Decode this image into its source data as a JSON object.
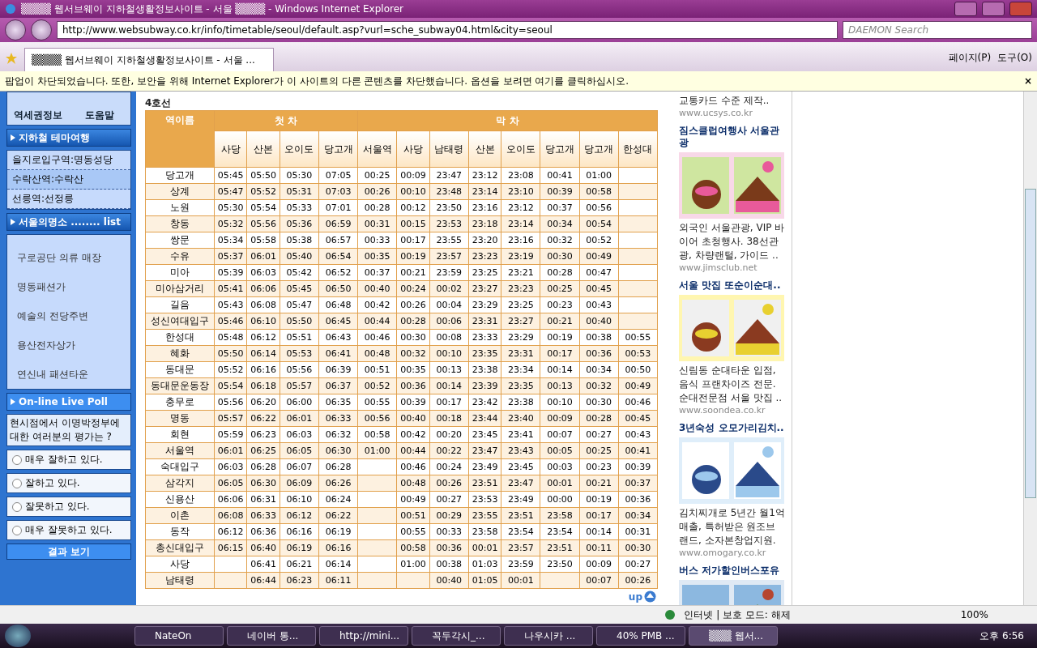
{
  "window": {
    "title": "▒▒▒▒ 웹서브웨이 지하철생활정보사이트 - 서울 ▒▒▒▒ - Windows Internet Explorer"
  },
  "address_bar": {
    "url": "http://www.websubway.co.kr/info/timetable/seoul/default.asp?vurl=sche_subway04.html&city=seoul",
    "search_placeholder": "DAEMON Search"
  },
  "tab": {
    "label": "▒▒▒▒ 웹서브웨이 지하철생활정보사이트 - 서울 ...",
    "selected": true
  },
  "toolbar": {
    "page_menu": "페이지(P)",
    "tools_menu": "도구(O)"
  },
  "info_bar": {
    "text": "팝업이 차단되었습니다. 또한, 보안을 위해 Internet Explorer가 이 사이트의 다른 콘텐츠를 차단했습니다. 옵션을 보려면 여기를 클릭하십시오.",
    "close": "×"
  },
  "sidebar": {
    "top_links": [
      "역세권정보",
      "도움말"
    ],
    "theme_travel": {
      "title": "지하철 테마여행",
      "items": [
        {
          "label": "을지로입구역:명동성당",
          "selected": false
        },
        {
          "label": "수락산역:수락산",
          "selected": true
        },
        {
          "label": "선릉역:선정릉",
          "selected": false
        }
      ]
    },
    "attractions": {
      "title": "서울의명소 ........ list",
      "items": [
        "구로공단 의류 매장",
        "명동패션가",
        "예술의 전당주변",
        "용산전자상가",
        "연신내 패션타운"
      ]
    },
    "poll": {
      "title": "On-line Live Poll",
      "question": "현시점에서 이명박정부에 대한 여러분의 평가는 ?",
      "options": [
        {
          "label": "매우 잘하고 있다.",
          "checked": false
        },
        {
          "label": "잘하고 있다.",
          "checked": false
        },
        {
          "label": "잘못하고 있다.",
          "checked": false
        },
        {
          "label": "매우 잘못하고 있다.",
          "checked": false
        }
      ],
      "button": "결과 보기"
    }
  },
  "timetable": {
    "line": "4호선",
    "station_header": "역이름",
    "groups": [
      {
        "label": "첫 차",
        "columns": [
          "사당",
          "산본",
          "오이도",
          "당고개"
        ]
      },
      {
        "label": "막 차",
        "columns": [
          "서울역",
          "사당",
          "남태령",
          "산본",
          "오이도",
          "당고개",
          "당고개",
          "한성대"
        ]
      }
    ],
    "rows": [
      {
        "station": "당고개",
        "cells": [
          "05:45",
          "05:50",
          "05:30",
          "07:05",
          "00:25",
          "00:09",
          "23:47",
          "23:12",
          "23:08",
          "00:41",
          "01:00",
          null
        ]
      },
      {
        "station": "상계",
        "cells": [
          "05:47",
          "05:52",
          "05:31",
          "07:03",
          "00:26",
          "00:10",
          "23:48",
          "23:14",
          "23:10",
          "00:39",
          "00:58",
          null
        ]
      },
      {
        "station": "노원",
        "cells": [
          "05:30",
          "05:54",
          "05:33",
          "07:01",
          "00:28",
          "00:12",
          "23:50",
          "23:16",
          "23:12",
          "00:37",
          "00:56",
          null
        ]
      },
      {
        "station": "창동",
        "cells": [
          "05:32",
          "05:56",
          "05:36",
          "06:59",
          "00:31",
          "00:15",
          "23:53",
          "23:18",
          "23:14",
          "00:34",
          "00:54",
          null
        ]
      },
      {
        "station": "쌍문",
        "cells": [
          "05:34",
          "05:58",
          "05:38",
          "06:57",
          "00:33",
          "00:17",
          "23:55",
          "23:20",
          "23:16",
          "00:32",
          "00:52",
          null
        ]
      },
      {
        "station": "수유",
        "cells": [
          "05:37",
          "06:01",
          "05:40",
          "06:54",
          "00:35",
          "00:19",
          "23:57",
          "23:23",
          "23:19",
          "00:30",
          "00:49",
          null
        ]
      },
      {
        "station": "미아",
        "cells": [
          "05:39",
          "06:03",
          "05:42",
          "06:52",
          "00:37",
          "00:21",
          "23:59",
          "23:25",
          "23:21",
          "00:28",
          "00:47",
          null
        ]
      },
      {
        "station": "미아삼거리",
        "cells": [
          "05:41",
          "06:06",
          "05:45",
          "06:50",
          "00:40",
          "00:24",
          "00:02",
          "23:27",
          "23:23",
          "00:25",
          "00:45",
          null
        ]
      },
      {
        "station": "길음",
        "cells": [
          "05:43",
          "06:08",
          "05:47",
          "06:48",
          "00:42",
          "00:26",
          "00:04",
          "23:29",
          "23:25",
          "00:23",
          "00:43",
          null
        ]
      },
      {
        "station": "성신여대입구",
        "cells": [
          "05:46",
          "06:10",
          "05:50",
          "06:45",
          "00:44",
          "00:28",
          "00:06",
          "23:31",
          "23:27",
          "00:21",
          "00:40",
          null
        ]
      },
      {
        "station": "한성대",
        "cells": [
          "05:48",
          "06:12",
          "05:51",
          "06:43",
          "00:46",
          "00:30",
          "00:08",
          "23:33",
          "23:29",
          "00:19",
          "00:38",
          "00:55"
        ]
      },
      {
        "station": "혜화",
        "cells": [
          "05:50",
          "06:14",
          "05:53",
          "06:41",
          "00:48",
          "00:32",
          "00:10",
          "23:35",
          "23:31",
          "00:17",
          "00:36",
          "00:53"
        ]
      },
      {
        "station": "동대문",
        "cells": [
          "05:52",
          "06:16",
          "05:56",
          "06:39",
          "00:51",
          "00:35",
          "00:13",
          "23:38",
          "23:34",
          "00:14",
          "00:34",
          "00:50"
        ]
      },
      {
        "station": "동대문운동장",
        "cells": [
          "05:54",
          "06:18",
          "05:57",
          "06:37",
          "00:52",
          "00:36",
          "00:14",
          "23:39",
          "23:35",
          "00:13",
          "00:32",
          "00:49"
        ]
      },
      {
        "station": "충무로",
        "cells": [
          "05:56",
          "06:20",
          "06:00",
          "06:35",
          "00:55",
          "00:39",
          "00:17",
          "23:42",
          "23:38",
          "00:10",
          "00:30",
          "00:46"
        ]
      },
      {
        "station": "명동",
        "cells": [
          "05:57",
          "06:22",
          "06:01",
          "06:33",
          "00:56",
          "00:40",
          "00:18",
          "23:44",
          "23:40",
          "00:09",
          "00:28",
          "00:45"
        ]
      },
      {
        "station": "회현",
        "cells": [
          "05:59",
          "06:23",
          "06:03",
          "06:32",
          "00:58",
          "00:42",
          "00:20",
          "23:45",
          "23:41",
          "00:07",
          "00:27",
          "00:43"
        ]
      },
      {
        "station": "서울역",
        "cells": [
          "06:01",
          "06:25",
          "06:05",
          "06:30",
          "01:00",
          "00:44",
          "00:22",
          "23:47",
          "23:43",
          "00:05",
          "00:25",
          "00:41"
        ]
      },
      {
        "station": "숙대입구",
        "cells": [
          "06:03",
          "06:28",
          "06:07",
          "06:28",
          null,
          "00:46",
          "00:24",
          "23:49",
          "23:45",
          "00:03",
          "00:23",
          "00:39"
        ]
      },
      {
        "station": "삼각지",
        "cells": [
          "06:05",
          "06:30",
          "06:09",
          "06:26",
          null,
          "00:48",
          "00:26",
          "23:51",
          "23:47",
          "00:01",
          "00:21",
          "00:37"
        ]
      },
      {
        "station": "신용산",
        "cells": [
          "06:06",
          "06:31",
          "06:10",
          "06:24",
          null,
          "00:49",
          "00:27",
          "23:53",
          "23:49",
          "00:00",
          "00:19",
          "00:36"
        ]
      },
      {
        "station": "이촌",
        "cells": [
          "06:08",
          "06:33",
          "06:12",
          "06:22",
          null,
          "00:51",
          "00:29",
          "23:55",
          "23:51",
          "23:58",
          "00:17",
          "00:34"
        ]
      },
      {
        "station": "동작",
        "cells": [
          "06:12",
          "06:36",
          "06:16",
          "06:19",
          null,
          "00:55",
          "00:33",
          "23:58",
          "23:54",
          "23:54",
          "00:14",
          "00:31"
        ]
      },
      {
        "station": "총신대입구",
        "cells": [
          "06:15",
          "06:40",
          "06:19",
          "06:16",
          null,
          "00:58",
          "00:36",
          "00:01",
          "23:57",
          "23:51",
          "00:11",
          "00:30"
        ]
      },
      {
        "station": "사당",
        "cells": [
          null,
          "06:41",
          "06:21",
          "06:14",
          null,
          "01:00",
          "00:38",
          "01:03",
          "23:59",
          "23:50",
          "00:09",
          "00:27"
        ]
      },
      {
        "station": "남태령",
        "cells": [
          null,
          "06:44",
          "06:23",
          "06:11",
          null,
          null,
          "00:40",
          "01:05",
          "00:01",
          null,
          "00:07",
          "00:26"
        ]
      }
    ],
    "up_link": "up"
  },
  "ads": [
    {
      "description": "교통카드 수준 제작..",
      "url": "www.ucsys.co.kr"
    },
    {
      "title": "짐스클럽여행사 서울관광",
      "kind": "picture",
      "description": "외국인 서울관광, VIP 바이어 초청행사. 38선관광, 차량랜털, 가이드 ..",
      "url": "www.jimsclub.net"
    },
    {
      "title": "서울 맛집 또순이순대..",
      "kind": "picture",
      "description": "신림동 순대타운 입점, 음식 프랜차이즈 전문. 순대전문점 서울 맛집 ..",
      "url": "www.soondea.co.kr"
    },
    {
      "title": "3년숙성 오모가리김치..",
      "kind": "picture",
      "description": "김치찌개로 5년간 월1억 매출, 특허받은 원조브랜드, 소자본창업지원.",
      "url": "www.omogary.co.kr"
    },
    {
      "title": "버스 저가할인버스포유",
      "kind": "picture"
    }
  ],
  "status_bar": {
    "zone": "인터넷 | 보호 모드: 해제",
    "zoom": "100%"
  },
  "taskbar": {
    "items": [
      {
        "label": "NateOn",
        "selected": false
      },
      {
        "label": "네이버 통...",
        "selected": false
      },
      {
        "label": "http://mini...",
        "selected": false
      },
      {
        "label": "꼭두각시_...",
        "selected": false
      },
      {
        "label": "나우시카 ...",
        "selected": false
      },
      {
        "label": "40% PMB ...",
        "selected": false
      },
      {
        "label": "▒▒▒ 웹서...",
        "selected": true
      }
    ],
    "clock": "오후 6:56"
  }
}
